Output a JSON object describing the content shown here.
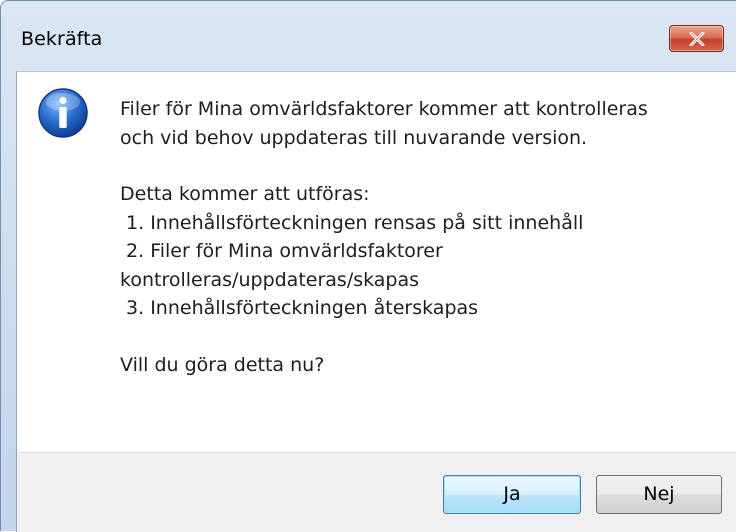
{
  "window": {
    "title": "Bekräfta"
  },
  "message": {
    "lines_1": [
      "Filer för Mina omvärldsfaktorer kommer att kontrolleras",
      "och vid behov uppdateras till nuvarande version."
    ],
    "lines_2": [
      "Detta kommer att utföras:",
      " 1. Innehållsförteckningen rensas på sitt innehåll",
      " 2. Filer för Mina omvärldsfaktorer",
      "kontrolleras/uppdateras/skapas",
      " 3. Innehållsförteckningen återskapas"
    ],
    "question": "Vill du göra detta nu?"
  },
  "buttons": {
    "yes_label": "Ja",
    "no_label": "Nej"
  },
  "icons": {
    "close": "close-icon",
    "info": "information-icon"
  },
  "colors": {
    "close_red": "#c5402a",
    "info_blue": "#1f63c6",
    "default_button_border": "#3c7fb1"
  }
}
